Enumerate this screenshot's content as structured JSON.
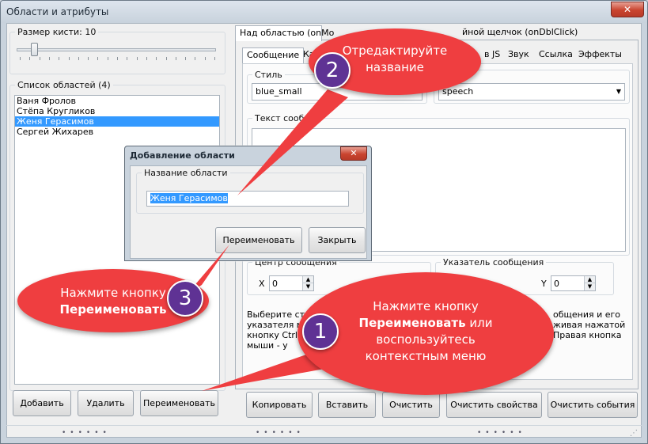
{
  "window": {
    "title": "Области и атрибуты",
    "close_glyph": "✕"
  },
  "left": {
    "brush_size_label": "Размер кисти: 10",
    "brush_size_value": 10,
    "areas_legend": "Список областей (4)",
    "areas": [
      "Ваня Фролов",
      "Стёпа Кругликов",
      "Женя Герасимов",
      "Сергей Жихарев"
    ],
    "selected_index": 2,
    "buttons": {
      "add": "Добавить",
      "delete": "Удалить",
      "rename": "Переименовать"
    }
  },
  "right": {
    "top_tabs": [
      "Над областью (onMo",
      "йной щелчок (onDblClick)"
    ],
    "sub_tabs": [
      "Сообщение",
      "Ка",
      "в JS",
      "Звук",
      "Ссылка",
      "Эффекты"
    ],
    "style_legend": "Стиль",
    "style_value": "blue_small",
    "style2_value": "speech",
    "text_legend": "Текст сообщ",
    "center_legend": "Центр сообщения",
    "pointer_legend": "Указатель сообщения",
    "x_label": "X",
    "x_value": "0",
    "y_label": "Y",
    "y_value": "0",
    "help_left": "Выберите сти\nуказателя мо\nкнопку Ctrl,\nмыши - у",
    "help_right": "общения и его\nживая нажатой\nПравая кнопка",
    "buttons": {
      "copy": "Копировать",
      "paste": "Вставить",
      "clear": "Очистить",
      "clear_props": "Очистить свойства",
      "clear_events": "Очистить события"
    }
  },
  "dialog": {
    "title": "Добавление области",
    "close_glyph": "✕",
    "name_legend": "Название области",
    "name_value": "Женя Герасимов",
    "rename": "Переименовать",
    "close": "Закрыть"
  },
  "callouts": {
    "c1": {
      "number": "1",
      "line1": "Нажмите кнопку",
      "line2_bold": "Переименовать",
      "line2_rest": " или",
      "line3": "воспользуйтесь",
      "line4": "контекстным меню"
    },
    "c2": {
      "number": "2",
      "line1": "Отредактируйте",
      "line2": "название"
    },
    "c3": {
      "number": "3",
      "line1": "Нажмите кнопку",
      "line2_bold": "Переименовать"
    }
  },
  "colors": {
    "callout": "#ef3e40",
    "badge": "#5f3294",
    "selection": "#3399ff"
  },
  "icons": {
    "spin_up": "▲",
    "spin_down": "▼",
    "dropdown": "▼",
    "grip": "⋰"
  }
}
